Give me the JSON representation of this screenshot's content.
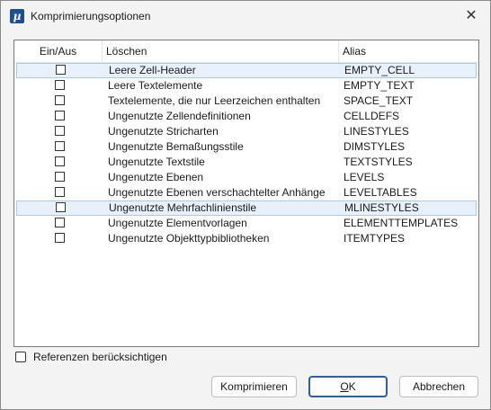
{
  "window": {
    "title": "Komprimierungsoptionen",
    "icon": "microstation-app-icon",
    "close_glyph": "✕"
  },
  "list": {
    "columns": [
      "Ein/Aus",
      "Löschen",
      "Alias"
    ],
    "rows": [
      {
        "checked": false,
        "description": "Leere Zell-Header",
        "alias": "EMPTY_CELL",
        "selected": true
      },
      {
        "checked": false,
        "description": "Leere Textelemente",
        "alias": "EMPTY_TEXT",
        "selected": false
      },
      {
        "checked": false,
        "description": "Textelemente, die nur Leerzeichen enthalten",
        "alias": "SPACE_TEXT",
        "selected": false
      },
      {
        "checked": false,
        "description": "Ungenutzte Zellendefinitionen",
        "alias": "CELLDEFS",
        "selected": false
      },
      {
        "checked": false,
        "description": "Ungenutzte Stricharten",
        "alias": "LINESTYLES",
        "selected": false
      },
      {
        "checked": false,
        "description": "Ungenutzte Bemaßungsstile",
        "alias": "DIMSTYLES",
        "selected": false
      },
      {
        "checked": false,
        "description": "Ungenutzte Textstile",
        "alias": "TEXTSTYLES",
        "selected": false
      },
      {
        "checked": false,
        "description": "Ungenutzte Ebenen",
        "alias": "LEVELS",
        "selected": false
      },
      {
        "checked": false,
        "description": "Ungenutzte Ebenen verschachtelter Anhänge",
        "alias": "LEVELTABLES",
        "selected": false
      },
      {
        "checked": false,
        "description": "Ungenutzte Mehrfachlinienstile",
        "alias": "MLINESTYLES",
        "selected": true
      },
      {
        "checked": false,
        "description": "Ungenutzte Elementvorlagen",
        "alias": "ELEMENTTEMPLATES",
        "selected": false
      },
      {
        "checked": false,
        "description": "Ungenutzte Objekttypbibliotheken",
        "alias": "ITEMTYPES",
        "selected": false
      }
    ]
  },
  "options": {
    "references_label": "Referenzen berücksichtigen",
    "references_checked": false
  },
  "buttons": {
    "compress": "Komprimieren",
    "ok_underlined": "O",
    "ok_rest": "K",
    "cancel": "Abbrechen"
  },
  "colors": {
    "selection_bg": "#e8f1fb",
    "selection_border": "#a9c9ed",
    "default_button_border": "#2b5fa8"
  }
}
